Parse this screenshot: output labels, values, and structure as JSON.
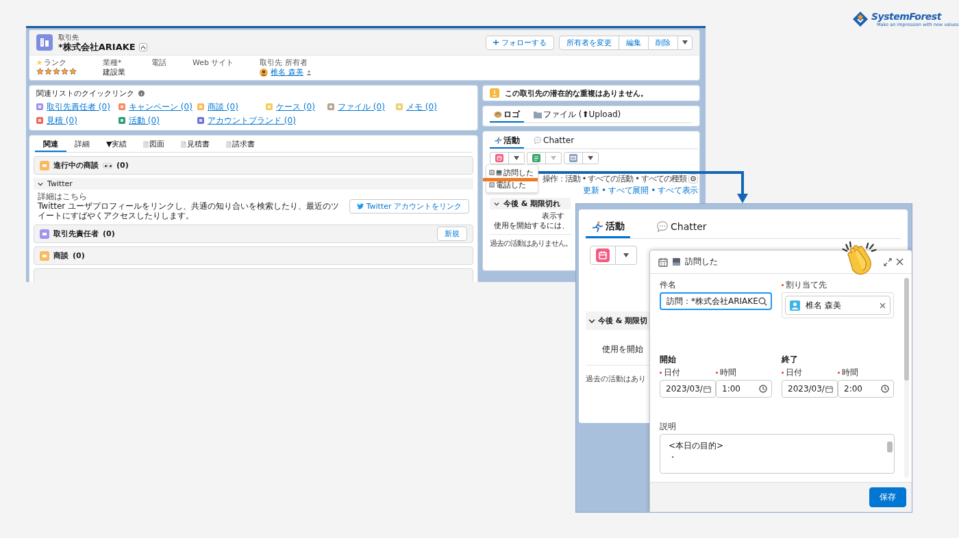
{
  "logo": {
    "name": "SystemForest",
    "tagline": "Make an impression with new values"
  },
  "record": {
    "object_label": "取引先",
    "title": "*株式会社ARIAKE",
    "follow": "フォローする",
    "actions": [
      "所有者を変更",
      "編集",
      "削除"
    ],
    "fields": [
      {
        "kind": "stars",
        "label": "ランク",
        "stars": 5
      },
      {
        "kind": "text",
        "label": "業種*",
        "value": "建設業"
      },
      {
        "kind": "text",
        "label": "電話"
      },
      {
        "kind": "text",
        "label": "Web サイト"
      },
      {
        "kind": "user",
        "label": "取引先 所有者",
        "value": "椎名 森美"
      }
    ]
  },
  "quick_links": {
    "title": "関連リストのクイックリンク",
    "items": [
      {
        "label": "取引先責任者 (0)",
        "color": "#a094ed"
      },
      {
        "label": "キャンペーン (0)",
        "color": "#f88962"
      },
      {
        "label": "商談 (0)",
        "color": "#fcb95b"
      },
      {
        "label": "ケース (0)",
        "color": "#f2cf5b"
      },
      {
        "label": "ファイル (0)",
        "color": "#b5a58e"
      },
      {
        "label": "メモ (0)",
        "color": "#e8d36f"
      },
      {
        "label": "見積 (0)",
        "color": "#ec6a5e"
      },
      {
        "label": "活動 (0)",
        "color": "#2e9a7c"
      },
      {
        "label": "アカウントブランド (0)",
        "color": "#6d72d8"
      }
    ]
  },
  "related_tabs": [
    {
      "label": "関連",
      "kind": "plain",
      "selected": true
    },
    {
      "label": "詳細",
      "kind": "plain",
      "selected": false
    },
    {
      "label": "▼実績",
      "kind": "plain",
      "selected": false
    },
    {
      "label": "図面",
      "kind": "doc",
      "selected": false
    },
    {
      "label": "見積書",
      "kind": "doc",
      "selected": false
    },
    {
      "label": "請求書",
      "kind": "doc",
      "selected": false
    }
  ],
  "related": [
    {
      "kind": "list",
      "title": "進行中の商談",
      "eyes": true,
      "count": "(0)",
      "color": "#fcb95b"
    },
    {
      "kind": "twitter",
      "title": "Twitter",
      "expanded": true,
      "link": "詳細はこちら",
      "text": "Twitter ユーザプロフィールをリンクし、共通の知り合いを検索したり、最近のツイートにすばやくアクセスしたりします。",
      "button": "Twitter アカウントをリンク"
    },
    {
      "kind": "list",
      "title": "取引先責任者",
      "eyes": false,
      "count": "(0)",
      "color": "#a094ed",
      "button": "新規"
    },
    {
      "kind": "list",
      "title": "商談",
      "eyes": false,
      "count": "(0)",
      "color": "#fcb95b"
    }
  ],
  "duplicates": {
    "message": "この取引先の潜在的な重複はありません。"
  },
  "media_tabs": [
    {
      "label": "ロゴ",
      "kind": "logo",
      "selected": true
    },
    {
      "label": "ファイル (⬆Upload)",
      "kind": "files",
      "selected": false
    }
  ],
  "activity": {
    "tabs": [
      {
        "label": "活動",
        "kind": "activity",
        "selected": true
      },
      {
        "label": "Chatter",
        "kind": "chatter",
        "selected": false
      }
    ],
    "menu": [
      {
        "label": "訪問した",
        "image": true,
        "selected": true
      },
      {
        "label": "電話した",
        "image": false,
        "selected": false
      }
    ],
    "filter": "操作：活動 • すべての活動 • すべての種類",
    "links": "更新 • すべて展開 • すべて表示",
    "section": {
      "title": "今後 & 期限切れ",
      "expanded": true
    },
    "lines": [
      "表示す",
      "使用を開始するには、"
    ],
    "past": "過去の活動はありません。"
  },
  "zoom": {
    "tabs": [
      {
        "label": "活動",
        "kind": "activity",
        "selected": true
      },
      {
        "label": "Chatter",
        "kind": "chatter",
        "selected": false
      }
    ],
    "section": {
      "title": "今後 & 期限切",
      "expanded": true
    },
    "line": "使用を開始",
    "past": "過去の活動はあり"
  },
  "composer": {
    "title": "訪問した",
    "subject": {
      "label": "件名",
      "required": false,
      "value": "訪問：*株式会社ARIAKE"
    },
    "assignee": {
      "label": "割り当て先",
      "required": true,
      "value": "椎名 森美"
    },
    "start": {
      "title": "開始",
      "date_label": "日付",
      "date": "2023/03/",
      "time_label": "時間",
      "time": "1:00",
      "required": true
    },
    "end": {
      "title": "終了",
      "date_label": "日付",
      "date": "2023/03/",
      "time_label": "時間",
      "time": "2:00",
      "required": true
    },
    "description": {
      "label": "説明",
      "value": "<本日の目的>\n・"
    },
    "save": "保存"
  }
}
